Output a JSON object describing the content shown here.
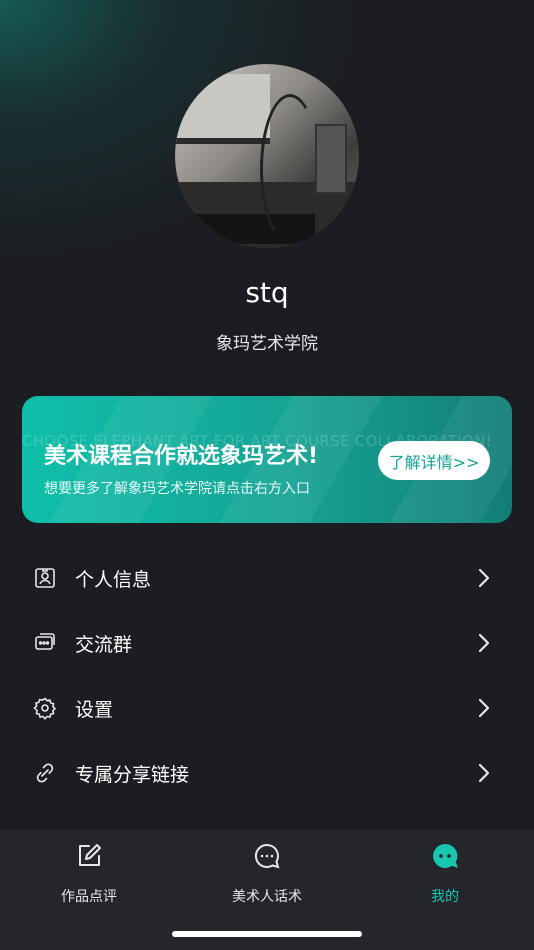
{
  "profile": {
    "username": "stq",
    "school": "象玛艺术学院"
  },
  "banner": {
    "watermark": "CHOOSE ELEPHANT ART FOR ART COURSE COLLABORATION!",
    "title": "美术课程合作就选象玛艺术!",
    "subtitle": "想要更多了解象玛艺术学院请点击右方入口",
    "button_label": "了解详情>>"
  },
  "menu": {
    "items": [
      {
        "label": "个人信息",
        "icon": "id-card-icon"
      },
      {
        "label": "交流群",
        "icon": "chat-group-icon"
      },
      {
        "label": "设置",
        "icon": "gear-icon"
      },
      {
        "label": "专属分享链接",
        "icon": "link-icon"
      }
    ]
  },
  "tabbar": {
    "tabs": [
      {
        "label": "作品点评",
        "icon": "edit-icon",
        "active": false
      },
      {
        "label": "美术人话术",
        "icon": "chat-bubble-icon",
        "active": false
      },
      {
        "label": "我的",
        "icon": "profile-bubble-icon",
        "active": true
      }
    ]
  },
  "colors": {
    "background": "#1b1d22",
    "accent": "#19c6b0",
    "tabbar": "#24262c"
  }
}
